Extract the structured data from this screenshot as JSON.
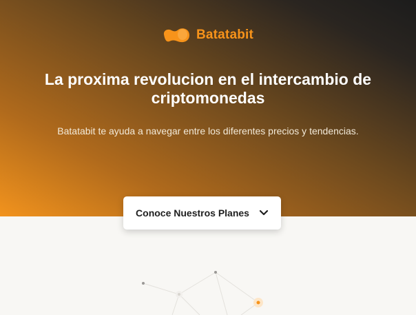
{
  "brand": {
    "name": "Batatabit",
    "logo_icon": "potato-logo-icon",
    "accent": "#f7931a"
  },
  "hero": {
    "title": "La proxima revolucion en el intercambio de criptomonedas",
    "subtitle": "Batatabit te ayuda a navegar entre los diferentes precios y tendencias."
  },
  "plans_button": {
    "label": "Conoce Nuestros Planes",
    "icon": "chevron-down-icon"
  },
  "decoration": {
    "icon": "network-graph-illustration"
  }
}
